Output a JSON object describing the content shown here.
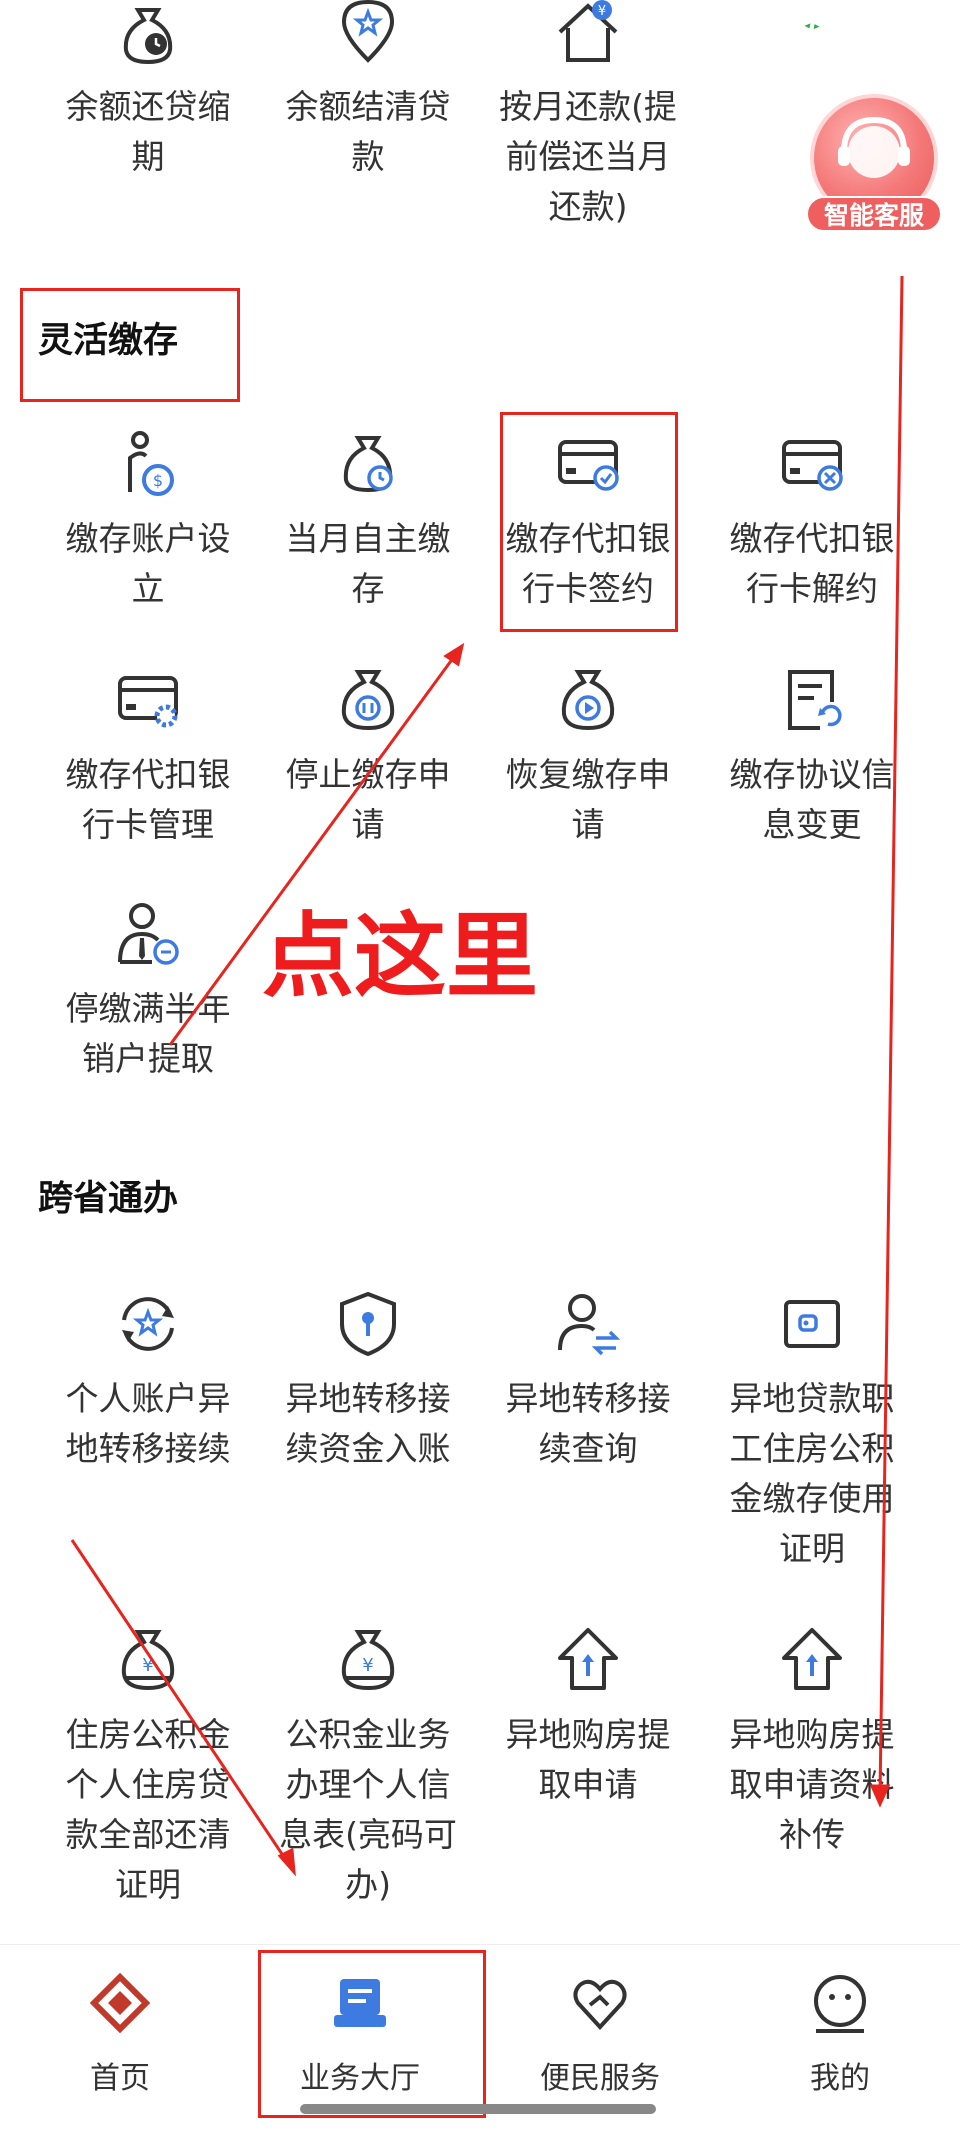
{
  "top_row": [
    {
      "label_l1": "余额还贷缩",
      "label_l2": "期",
      "label_l3": "",
      "icon": "moneybag-clock-icon"
    },
    {
      "label_l1": "余额结清贷",
      "label_l2": "款",
      "label_l3": "",
      "icon": "location-star-icon"
    },
    {
      "label_l1": "按月还款(提",
      "label_l2": "前偿还当月",
      "label_l3": "还款)",
      "icon": "house-yen-icon"
    },
    {
      "label_l1": "",
      "label_l2": "",
      "label_l3": "",
      "icon": "swap-arrows-icon"
    }
  ],
  "float_service": {
    "label": "智能客服",
    "icon": "customer-service-icon"
  },
  "sections": {
    "flexible": {
      "title": "灵活缴存",
      "items": [
        {
          "l1": "缴存账户设",
          "l2": "立",
          "icon": "person-dollar-icon"
        },
        {
          "l1": "当月自主缴",
          "l2": "存",
          "icon": "moneybag-clock-icon"
        },
        {
          "l1": "缴存代扣银",
          "l2": "行卡签约",
          "icon": "card-check-icon"
        },
        {
          "l1": "缴存代扣银",
          "l2": "行卡解约",
          "icon": "card-cancel-icon"
        },
        {
          "l1": "缴存代扣银",
          "l2": "行卡管理",
          "icon": "card-gear-icon"
        },
        {
          "l1": "停止缴存申",
          "l2": "请",
          "icon": "moneybag-pause-icon"
        },
        {
          "l1": "恢复缴存申",
          "l2": "请",
          "icon": "moneybag-play-icon"
        },
        {
          "l1": "缴存协议信",
          "l2": "息变更",
          "icon": "document-refresh-icon"
        },
        {
          "l1": "停缴满半年",
          "l2": "销户提取",
          "icon": "person-minus-icon"
        }
      ]
    },
    "cross_province": {
      "title": "跨省通办",
      "items": [
        {
          "l1": "个人账户异",
          "l2": "地转移接续",
          "l3": "",
          "l4": "",
          "icon": "circle-star-icon"
        },
        {
          "l1": "异地转移接",
          "l2": "续资金入账",
          "l3": "",
          "l4": "",
          "icon": "shield-key-icon"
        },
        {
          "l1": "异地转移接",
          "l2": "续查询",
          "l3": "",
          "l4": "",
          "icon": "person-transfer-icon"
        },
        {
          "l1": "异地贷款职",
          "l2": "工住房公积",
          "l3": "金缴存使用",
          "l4": "证明",
          "icon": "wallet-icon"
        },
        {
          "l1": "住房公积金",
          "l2": "个人住房贷",
          "l3": "款全部还清",
          "l4": "证明",
          "icon": "moneybag-yen-icon"
        },
        {
          "l1": "公积金业务",
          "l2": "办理个人信",
          "l3": "息表(亮码可",
          "l4": "办)",
          "icon": "moneybag-yen-icon"
        },
        {
          "l1": "异地购房提",
          "l2": "取申请",
          "l3": "",
          "l4": "",
          "icon": "house-arrow-icon"
        },
        {
          "l1": "异地购房提",
          "l2": "取申请资料",
          "l3": "补传",
          "l4": "",
          "icon": "house-arrow-icon"
        }
      ]
    }
  },
  "annotation": {
    "text": "点这里"
  },
  "tabbar": [
    {
      "label": "首页",
      "icon": "home-logo-icon",
      "color": "#c0392b"
    },
    {
      "label": "业务大厅",
      "icon": "business-hall-icon",
      "color": "#3d7be0"
    },
    {
      "label": "便民服务",
      "icon": "heart-hands-icon",
      "color": "#333333"
    },
    {
      "label": "我的",
      "icon": "smile-face-icon",
      "color": "#333333"
    }
  ],
  "colors": {
    "icon_dark": "#333333",
    "icon_accent": "#3d7be0",
    "annotation_red": "#e8241f"
  }
}
